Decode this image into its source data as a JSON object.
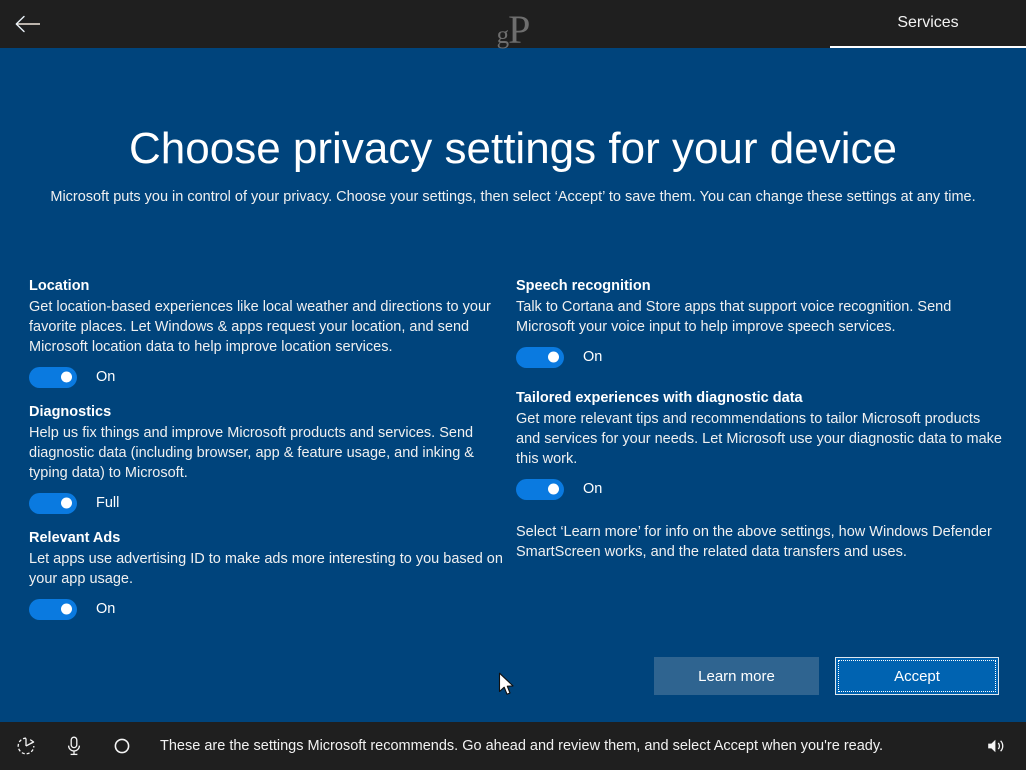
{
  "header": {
    "back_icon": "back-arrow-icon",
    "watermark_small": "g",
    "watermark_large": "P",
    "tab_label": "Services"
  },
  "page": {
    "title": "Choose privacy settings for your device",
    "subtitle": "Microsoft puts you in control of your privacy. Choose your settings, then select ‘Accept’ to save them. You can change these settings at any time."
  },
  "settings_left": [
    {
      "title": "Location",
      "description": "Get location-based experiences like local weather and directions to your favorite places. Let Windows & apps request your location, and send Microsoft location data to help improve location services.",
      "toggle_state": "On"
    },
    {
      "title": "Diagnostics",
      "description": "Help us fix things and improve Microsoft products and services. Send diagnostic data (including browser, app & feature usage, and inking & typing data) to Microsoft.",
      "toggle_state": "Full"
    },
    {
      "title": "Relevant Ads",
      "description": "Let apps use advertising ID to make ads more interesting to you based on your app usage.",
      "toggle_state": "On"
    }
  ],
  "settings_right": [
    {
      "title": "Speech recognition",
      "description": "Talk to Cortana and Store apps that support voice recognition. Send Microsoft your voice input to help improve speech services.",
      "toggle_state": "On"
    },
    {
      "title": "Tailored experiences with diagnostic data",
      "description": "Get more relevant tips and recommendations to tailor Microsoft products and services for your needs. Let Microsoft use your diagnostic data to make this work.",
      "toggle_state": "On"
    }
  ],
  "right_note": "Select ‘Learn more’ for info on the above settings, how Windows Defender SmartScreen works, and the related data transfers and uses.",
  "buttons": {
    "learn_more": "Learn more",
    "accept": "Accept"
  },
  "statusbar": {
    "message": "These are the settings Microsoft recommends. Go ahead and review them, and select Accept when you're ready.",
    "icons": [
      "ease-of-access-icon",
      "microphone-icon",
      "cortana-circle-icon",
      "volume-icon"
    ]
  },
  "colors": {
    "page_background": "#00447c",
    "chrome_background": "#1f1f1f",
    "toggle_on": "#0a7ae0",
    "accept_button": "#0063b1",
    "learn_more_button": "#2f6490"
  }
}
